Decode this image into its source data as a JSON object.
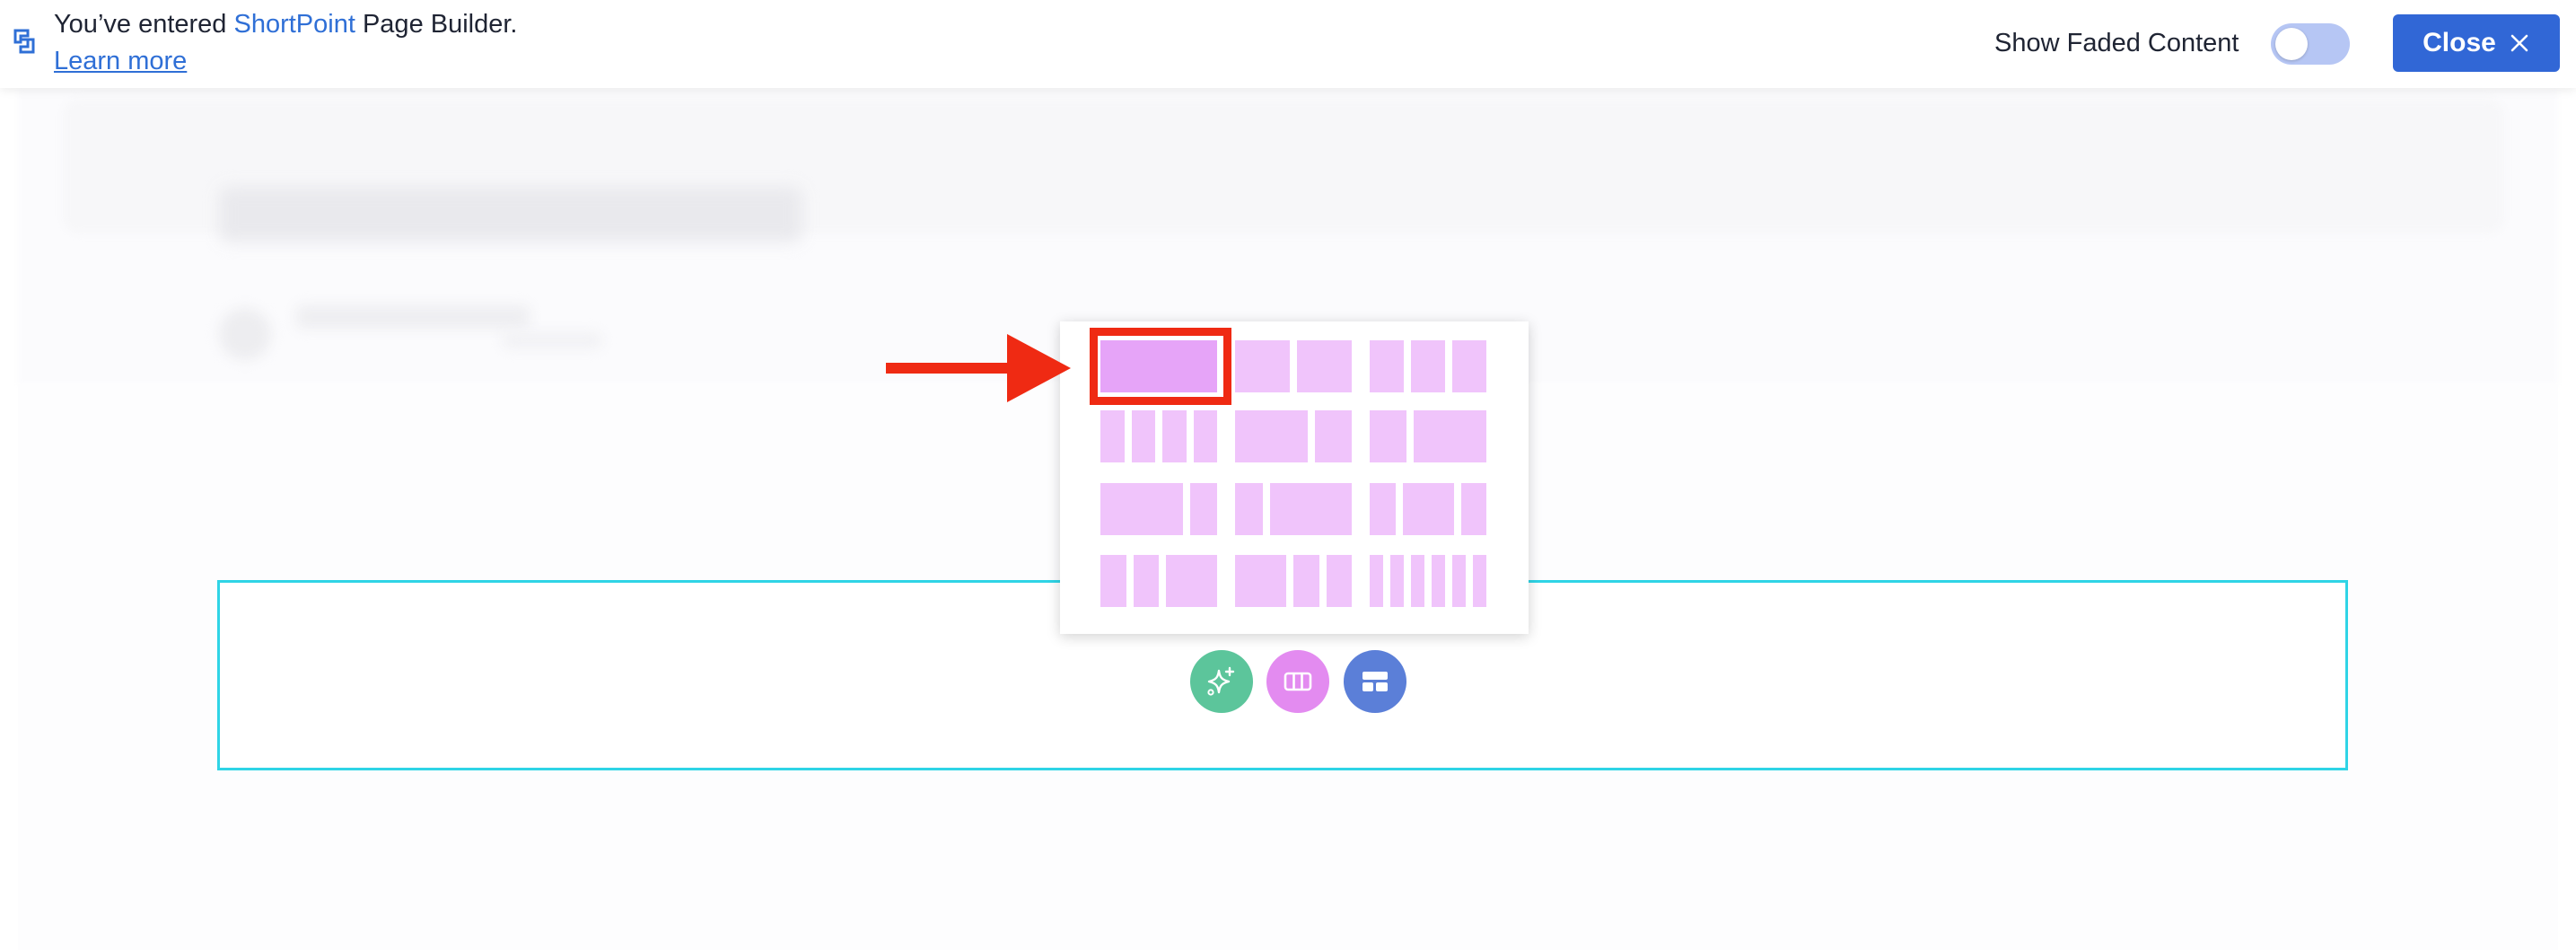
{
  "topbar": {
    "message_prefix": "You’ve entered ",
    "brand": "ShortPoint",
    "message_suffix": " Page Builder.",
    "learn_more": "Learn more",
    "show_faded_label": "Show Faded Content",
    "show_faded_enabled": false,
    "close_label": "Close"
  },
  "section": {
    "buttons": [
      {
        "name": "ai-button",
        "icon": "sparkles-icon",
        "color": "#5cc59b"
      },
      {
        "name": "columns-button",
        "icon": "columns-icon",
        "color": "#e38bf0"
      },
      {
        "name": "layout-button",
        "icon": "layout-icon",
        "color": "#5b7fd8"
      }
    ],
    "border_color": "#2fd4e6"
  },
  "layout_picker": {
    "selected_index": 0,
    "options": [
      {
        "name": "layout-1-column",
        "columns": [
          12
        ]
      },
      {
        "name": "layout-2-equal-columns",
        "columns": [
          6,
          6
        ]
      },
      {
        "name": "layout-3-equal-columns",
        "columns": [
          4,
          4,
          4
        ]
      },
      {
        "name": "layout-4-equal-columns",
        "columns": [
          3,
          3,
          3,
          3
        ]
      },
      {
        "name": "layout-2-columns-wide-left",
        "columns": [
          8,
          4
        ]
      },
      {
        "name": "layout-2-columns-wide-right",
        "columns": [
          4,
          8
        ]
      },
      {
        "name": "layout-2-columns-narrow-right",
        "columns": [
          9,
          3
        ]
      },
      {
        "name": "layout-2-columns-narrow-left",
        "columns": [
          3,
          9
        ]
      },
      {
        "name": "layout-3-columns-wide-center",
        "columns": [
          3,
          6,
          3
        ]
      },
      {
        "name": "layout-3-columns-wide-right",
        "columns": [
          3,
          3,
          6
        ]
      },
      {
        "name": "layout-3-columns-wide-left",
        "columns": [
          6,
          3,
          3
        ]
      },
      {
        "name": "layout-6-equal-columns",
        "columns": [
          2,
          2,
          2,
          2,
          2,
          2
        ]
      }
    ]
  },
  "colors": {
    "accent": "#3167d6",
    "annotation": "#ef2a13",
    "layout_cell": "#f0c4fb",
    "layout_cell_selected": "#e6a4f8"
  }
}
